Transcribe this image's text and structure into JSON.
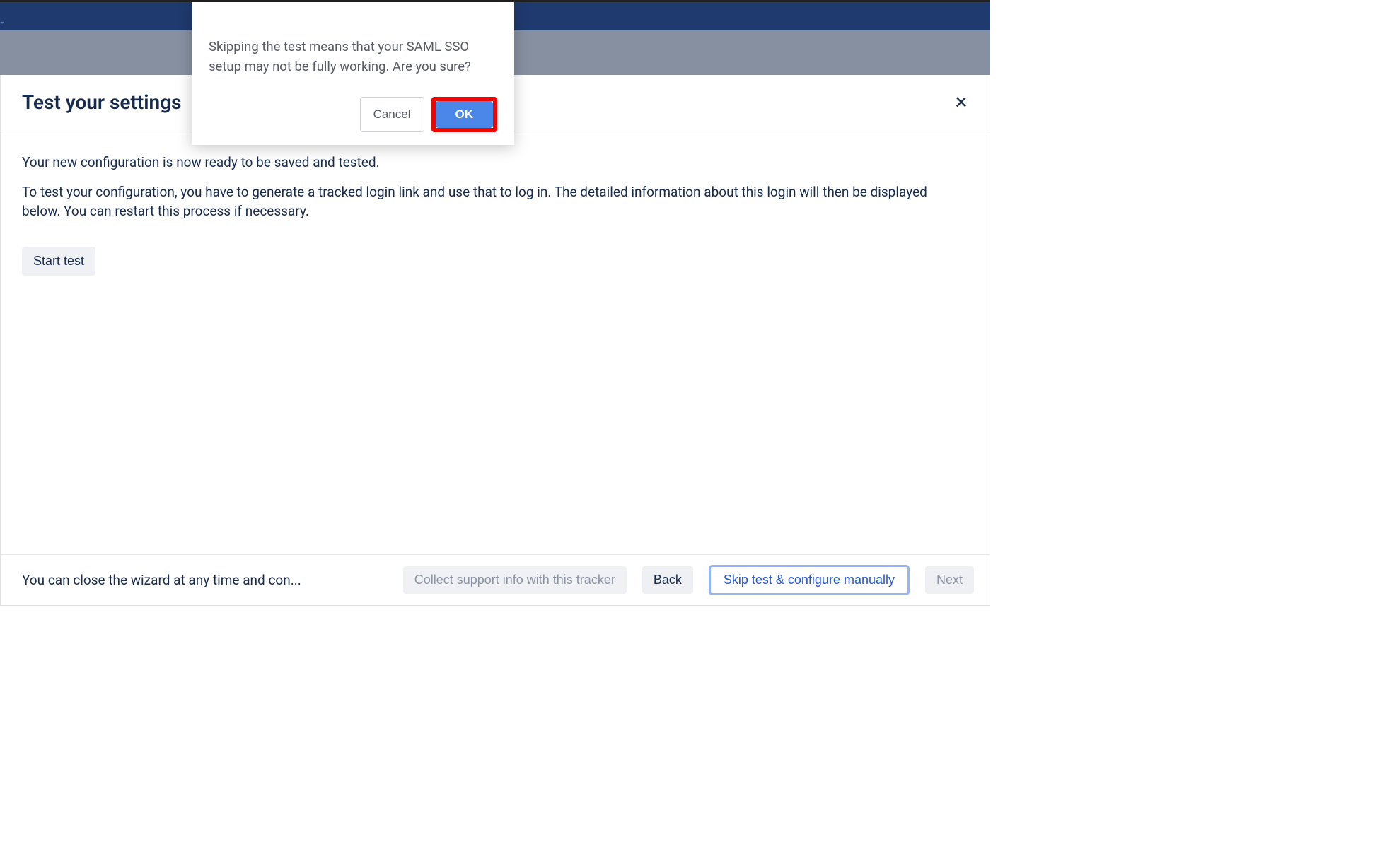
{
  "page": {
    "title": "Test your settings",
    "intro1": "Your new configuration is now ready to be saved and tested.",
    "intro2": "To test your configuration, you have to generate a tracked login link and use that to log in. The detailed information about this login will then be displayed below. You can restart this process if necessary.",
    "start_test_label": "Start test"
  },
  "footer": {
    "hint": "You can close the wizard at any time and con...",
    "collect_label": "Collect support info with this tracker",
    "back_label": "Back",
    "skip_label": "Skip test & configure manually",
    "next_label": "Next"
  },
  "modal": {
    "message": "Skipping the test means that your SAML SSO setup may not be fully working. Are you sure?",
    "cancel_label": "Cancel",
    "ok_label": "OK"
  }
}
